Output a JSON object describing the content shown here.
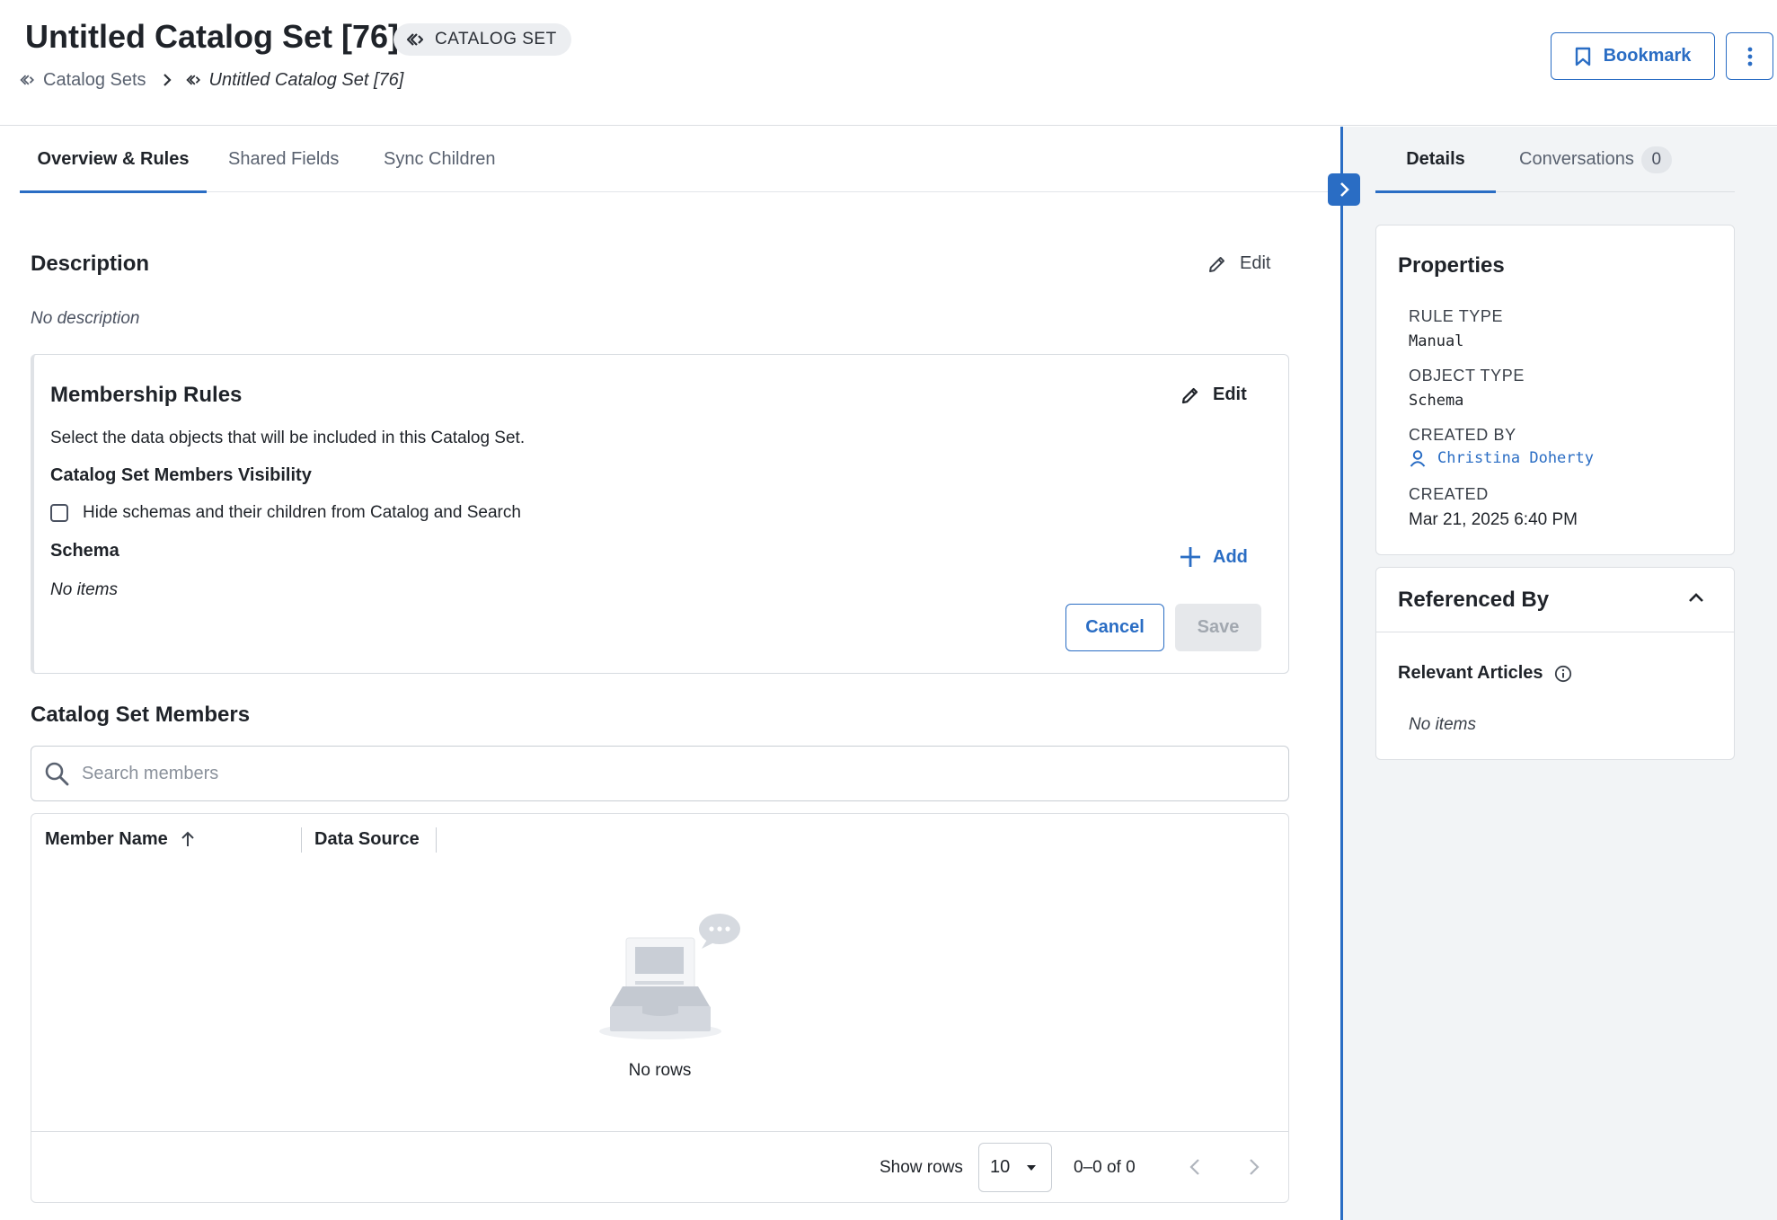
{
  "header": {
    "title": "Untitled Catalog Set [76]",
    "type_badge": "CATALOG SET",
    "breadcrumb": {
      "parent": "Catalog Sets",
      "current": "Untitled Catalog Set [76]"
    },
    "bookmark_label": "Bookmark"
  },
  "tabs": [
    {
      "label": "Overview & Rules",
      "active": true
    },
    {
      "label": "Shared Fields",
      "active": false
    },
    {
      "label": "Sync Children",
      "active": false
    }
  ],
  "description": {
    "title": "Description",
    "edit_label": "Edit",
    "value": "No description"
  },
  "membership_rules": {
    "title": "Membership Rules",
    "edit_label": "Edit",
    "intro": "Select the data objects that will be included in this Catalog Set.",
    "visibility_title": "Catalog Set Members Visibility",
    "hide_checkbox_label": "Hide schemas and their children from Catalog and Search",
    "hide_checked": false,
    "schema_title": "Schema",
    "add_label": "Add",
    "schema_items_empty": "No items",
    "cancel_label": "Cancel",
    "save_label": "Save"
  },
  "members": {
    "title": "Catalog Set Members",
    "search_placeholder": "Search members",
    "columns": [
      "Member Name",
      "Data Source"
    ],
    "empty_text": "No rows",
    "show_rows_label": "Show rows",
    "rows_per_page": "10",
    "range_text": "0–0 of 0"
  },
  "right_panel": {
    "tabs": [
      {
        "label": "Details",
        "active": true
      },
      {
        "label": "Conversations",
        "count": "0",
        "active": false
      }
    ],
    "properties": {
      "title": "Properties",
      "rule_type_label": "RULE TYPE",
      "rule_type_value": "Manual",
      "object_type_label": "OBJECT TYPE",
      "object_type_value": "Schema",
      "created_by_label": "CREATED BY",
      "created_by_value": "Christina Doherty",
      "created_label": "CREATED",
      "created_value": "Mar 21, 2025 6:40 PM"
    },
    "referenced_by": {
      "title": "Referenced By",
      "relevant_articles_label": "Relevant Articles",
      "empty_text": "No items"
    }
  },
  "colors": {
    "accent": "#2a6dc4",
    "text": "#1f2329",
    "muted": "#5a6270",
    "panel_bg": "#f2f4f6",
    "disabled_bg": "#e6e8eb"
  },
  "icons": [
    "catalog-set-icon",
    "chevron-right-icon",
    "bookmark-icon",
    "more-vertical-icon",
    "pencil-icon",
    "plus-icon",
    "search-icon",
    "sort-ascending-icon",
    "empty-inbox-icon",
    "caret-down-icon",
    "chevron-left-icon",
    "user-icon",
    "chevron-up-icon",
    "info-icon"
  ]
}
